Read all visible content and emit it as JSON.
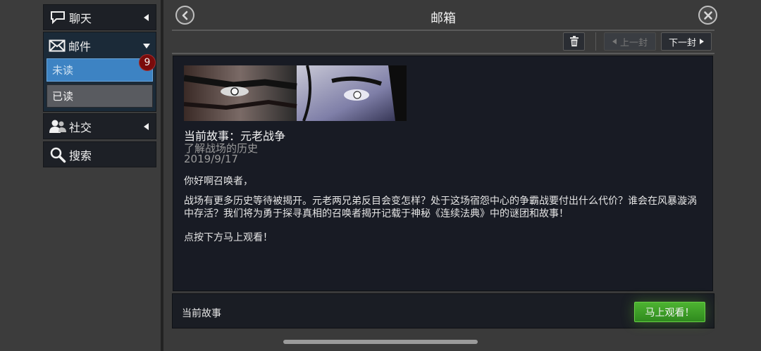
{
  "sidebar": {
    "items": [
      {
        "label": "聊天",
        "icon": "chat-icon"
      },
      {
        "label": "邮件",
        "icon": "mail-icon"
      },
      {
        "label": "社交",
        "icon": "friends-icon"
      },
      {
        "label": "搜索",
        "icon": "search-icon"
      }
    ],
    "mail_sub": [
      {
        "label": "未读"
      },
      {
        "label": "已读"
      }
    ],
    "unread_count": "9"
  },
  "header": {
    "title": "邮箱"
  },
  "toolbar": {
    "prev_label": "上一封",
    "next_label": "下一封"
  },
  "message": {
    "title": "当前故事：元老战争",
    "subtitle": "了解战场的历史",
    "date": "2019/9/17",
    "greeting": "你好啊召唤者，",
    "body": "战场有更多历史等待被揭开。元老两兄弟反目会变怎样？处于这场宿怨中心的争霸战要付出什么代价？谁会在风暴漩涡中存活？我们将为勇于探寻真相的召唤者揭开记载于神秘《连续法典》中的谜团和故事！",
    "cta": "点按下方马上观看！"
  },
  "footer": {
    "label": "当前故事",
    "button": "马上观看！"
  },
  "colors": {
    "accent_green": "#3f9f26",
    "unread_blue": "#3d83c3",
    "badge_red": "#7a0b0b"
  }
}
